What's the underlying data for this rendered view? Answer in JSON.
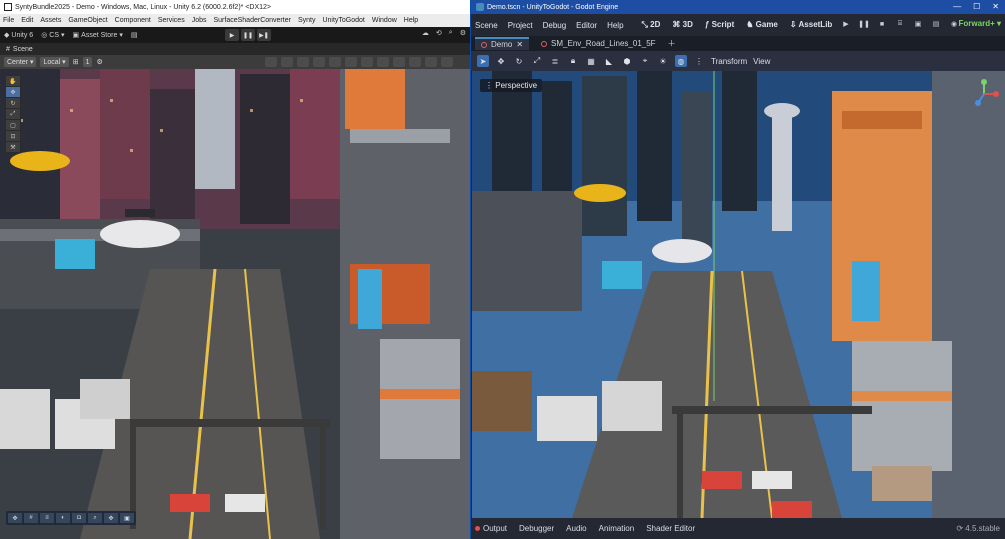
{
  "unity": {
    "title": "SyntyBundle2025 - Demo - Windows, Mac, Linux - Unity 6.2 (6000.2.6f2)* <DX12>",
    "menu": [
      "File",
      "Edit",
      "Assets",
      "GameObject",
      "Component",
      "Services",
      "Jobs",
      "SurfaceShaderConverter",
      "Synty",
      "UnityToGodot",
      "Window",
      "Help"
    ],
    "toolbar": {
      "account": "Unity 6",
      "cs": "CS",
      "asset_store": "Asset Store"
    },
    "scene_tab": "Scene",
    "scene_bar": {
      "pivot": "Center",
      "space": "Local",
      "snap_value": "1"
    }
  },
  "godot": {
    "title": "Demo.tscn - UnityToGodot - Godot Engine",
    "menu": [
      "Scene",
      "Project",
      "Debug",
      "Editor",
      "Help"
    ],
    "workspaces": [
      "2D",
      "3D",
      "Script",
      "Game",
      "AssetLib"
    ],
    "renderer": "Forward+",
    "tabs": [
      {
        "label": "Demo"
      },
      {
        "label": "SM_Env_Road_Lines_01_5F"
      }
    ],
    "toolbar": {
      "transform": "Transform",
      "view": "View"
    },
    "viewport_label": "Perspective",
    "bottom_tabs": [
      "Output",
      "Debugger",
      "Audio",
      "Animation",
      "Shader Editor"
    ],
    "version": "4.5.stable"
  },
  "colors": {
    "godot_accent": "#478cbf",
    "godot_title": "#1d4ea3",
    "renderer_green": "#7fd36b"
  }
}
